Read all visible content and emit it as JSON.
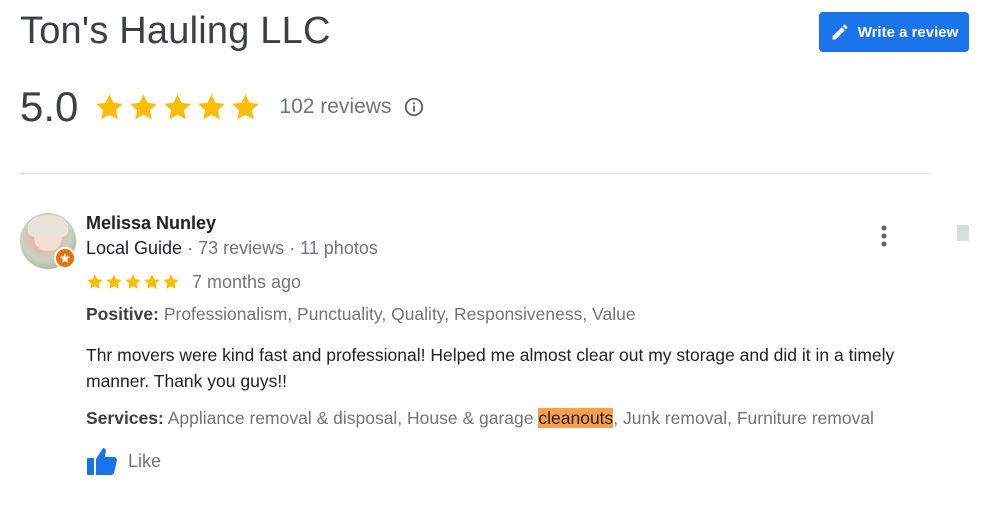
{
  "business": {
    "name": "Ton's Hauling LLC",
    "write_review_label": "Write a review",
    "rating": "5.0",
    "stars": 5,
    "review_count": "102 reviews"
  },
  "review": {
    "reviewer_name": "Melissa Nunley",
    "guide_label": "Local Guide",
    "meta": " · 73 reviews · 11 photos",
    "stars": 5,
    "date": "7 months ago",
    "positive_label": "Positive:",
    "positive_value": " Professionalism, Punctuality, Quality, Responsiveness, Value",
    "text": "Thr movers were kind fast and professional! Helped me almost clear out my storage and did it in a timely manner. Thank you guys!!",
    "services_label": "Services:",
    "services_before": " Appliance removal & disposal, House & garage ",
    "services_highlight": "cleanouts",
    "services_after": ", Junk removal, Furniture removal",
    "like_label": "Like"
  },
  "colors": {
    "accent": "#1a73e8",
    "star": "#fbbc04",
    "highlight": "#f6a04d",
    "guide_badge": "#e8710a"
  },
  "icons": [
    "pencil-icon",
    "star-icon",
    "info-icon",
    "more-vert-icon",
    "thumbs-up-icon",
    "local-guide-badge-icon"
  ]
}
